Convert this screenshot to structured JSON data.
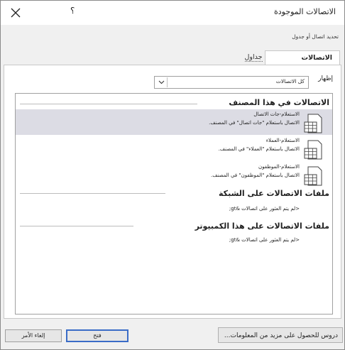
{
  "dialog": {
    "title": "الاتصالات الموجودة",
    "help_label": "؟",
    "instruction": "تحديد اتصال أو جدول"
  },
  "tabs": [
    {
      "label": "الاتصالات",
      "active": true
    },
    {
      "label": "جداول",
      "active": false
    }
  ],
  "show": {
    "label": "إظهار",
    "selected": "كل الاتصالات"
  },
  "sections": {
    "workbook": {
      "title": "الاتصالات في هذا المصنف",
      "items": [
        {
          "name": "الاستعلام-جات الاتصال",
          "desc": "الاتصال باستعلام \"جات اتصال\" في المصنف.",
          "selected": true
        },
        {
          "name": "الاستعلام-العملاء",
          "desc": "الاتصال باستعلام \"العملاء\" في المصنف.",
          "selected": false
        },
        {
          "name": "الاستعلام-الموظفون",
          "desc": "الاتصال باستعلام \"الموظفون\" في المصنف.",
          "selected": false
        }
      ]
    },
    "network": {
      "title": "ملفات الاتصالات على الشبكة",
      "empty": "<لم يتم العثور على اتصالات &gt;"
    },
    "computer": {
      "title": "ملفات الاتصالات على هذا الكمبيوتر",
      "empty": "<لم يتم العثور على اتصالات &gt;"
    }
  },
  "buttons": {
    "browse": "دروس للحصول على مزيد من المعلومات...",
    "open": "فتح",
    "cancel": "إلغاء الأمر"
  },
  "colors": {
    "selected_row": "#dcdce4",
    "default_button_border": "#3a6cc7"
  }
}
